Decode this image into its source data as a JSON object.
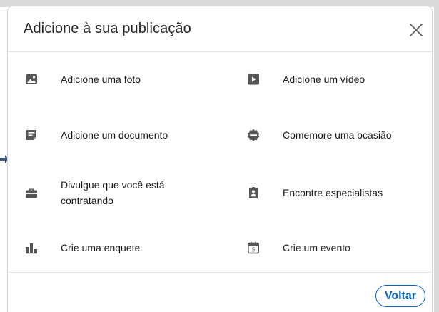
{
  "modal": {
    "title": "Adicione à sua publicação",
    "close_label": "Fechar"
  },
  "options": [
    {
      "key": "photo",
      "label": "Adicione uma foto",
      "icon": "image-icon"
    },
    {
      "key": "video",
      "label": "Adicione um vídeo",
      "icon": "video-play-icon"
    },
    {
      "key": "document",
      "label": "Adicione um documento",
      "icon": "document-icon"
    },
    {
      "key": "celebrate",
      "label": "Comemore uma ocasião",
      "icon": "celebration-badge-icon"
    },
    {
      "key": "hiring",
      "label": "Divulgue que você está contratando",
      "icon": "briefcase-icon"
    },
    {
      "key": "experts",
      "label": "Encontre especialistas",
      "icon": "clipboard-badge-icon"
    },
    {
      "key": "poll",
      "label": "Crie uma enquete",
      "icon": "poll-chart-icon"
    },
    {
      "key": "event",
      "label": "Crie um evento",
      "icon": "calendar-icon"
    }
  ],
  "footer": {
    "back_label": "Voltar"
  },
  "colors": {
    "icon": "#565656",
    "text": "#191919",
    "accent": "#0a66c2",
    "divider": "#e3e3e3"
  }
}
